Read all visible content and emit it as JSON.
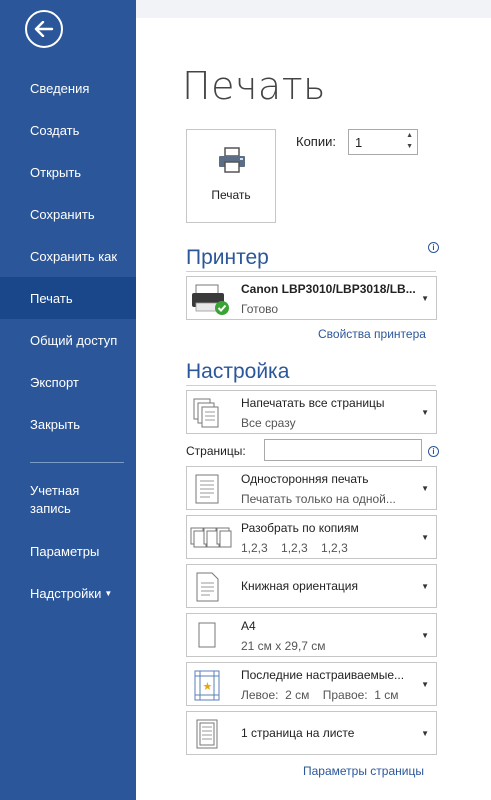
{
  "sidebar": {
    "items": [
      {
        "label": "Сведения"
      },
      {
        "label": "Создать"
      },
      {
        "label": "Открыть"
      },
      {
        "label": "Сохранить"
      },
      {
        "label": "Сохранить как"
      },
      {
        "label": "Печать"
      },
      {
        "label": "Общий доступ"
      },
      {
        "label": "Экспорт"
      },
      {
        "label": "Закрыть"
      },
      {
        "label": "Учетная запись"
      },
      {
        "label": "Параметры"
      },
      {
        "label": "Надстройки"
      }
    ],
    "active": "Печать"
  },
  "page": {
    "title": "Печать",
    "print_button": "Печать",
    "copies_label": "Копии:",
    "copies_value": "1"
  },
  "printer": {
    "heading": "Принтер",
    "name": "Canon LBP3010/LBP3018/LB...",
    "status": "Готово",
    "properties_link": "Свойства принтера"
  },
  "settings": {
    "heading": "Настройка",
    "pages_label": "Страницы:",
    "items": [
      {
        "line1": "Напечатать все страницы",
        "line2": "Все сразу",
        "icon": "pages-icon"
      },
      {
        "line1": "Односторонняя печать",
        "line2": "Печатать только на одной...",
        "icon": "one-sided-icon"
      },
      {
        "line1": "Разобрать по копиям",
        "line2": "1,2,3    1,2,3    1,2,3",
        "icon": "collate-icon"
      },
      {
        "line1": "Книжная ориентация",
        "line2": "",
        "icon": "portrait-icon"
      },
      {
        "line1": "A4",
        "line2": "21 см x 29,7 см",
        "icon": "paper-size-icon"
      },
      {
        "line1": "Последние настраиваемые...",
        "line2": "Левое:  2 см    Правое:  1 см",
        "icon": "margins-icon"
      },
      {
        "line1": "1 страница на листе",
        "line2": "",
        "icon": "pages-per-sheet-icon"
      }
    ],
    "page_setup_link": "Параметры страницы"
  },
  "colors": {
    "sidebar": "#2b579a",
    "sidebar_active": "#19478a",
    "accent": "#2b579a"
  }
}
